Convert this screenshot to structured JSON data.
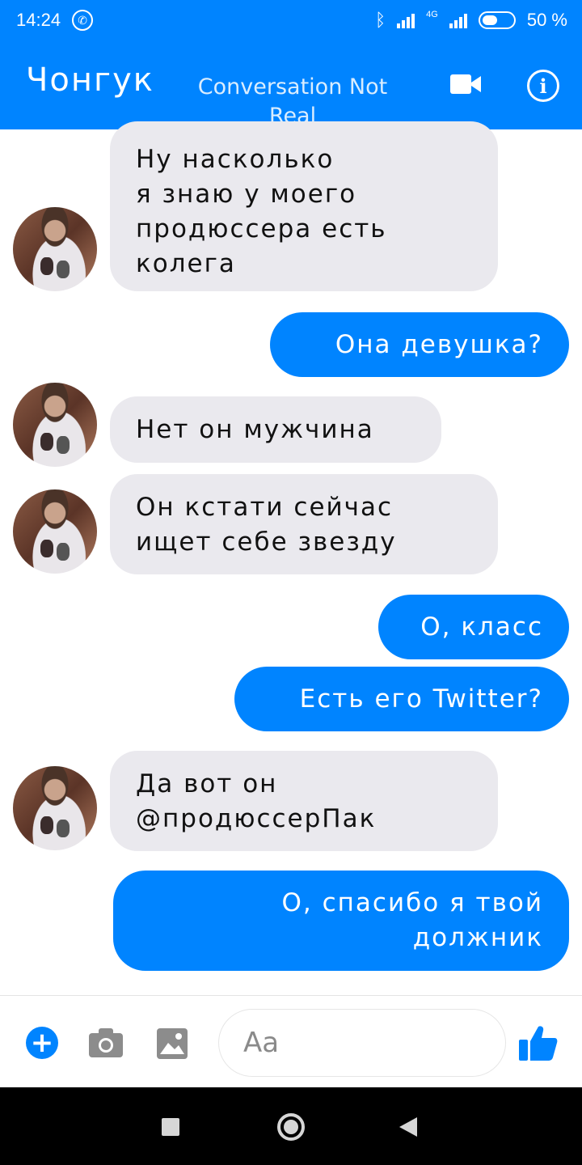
{
  "status_bar": {
    "time": "14:24",
    "network": "4G",
    "battery": "50 %",
    "battery_level": 0.5
  },
  "header": {
    "contact_name": "Чонгук",
    "subtitle": "Conversation Not Real",
    "icons": [
      "video-camera-icon",
      "info-icon"
    ]
  },
  "messages": [
    {
      "direction": "incoming",
      "text": "Ну  насколько\nя знаю у моего\nпродюссера есть\nколега"
    },
    {
      "direction": "outgoing",
      "text": "Она девушка?"
    },
    {
      "direction": "incoming",
      "text": "Нет он мужчина"
    },
    {
      "direction": "incoming",
      "text": "Он кстати сейчас\nищет себе звезду"
    },
    {
      "direction": "outgoing",
      "text": "О, класс"
    },
    {
      "direction": "outgoing",
      "text": "Есть его Twitter?"
    },
    {
      "direction": "incoming",
      "text": "Да вот он\n@продюссерПак"
    },
    {
      "direction": "outgoing",
      "text": "О, спасибо я твой\nдолжник"
    }
  ],
  "composer": {
    "placeholder": "Aa",
    "icons": [
      "plus-icon",
      "camera-icon",
      "gallery-icon",
      "thumbs-up-icon"
    ]
  },
  "colors": {
    "accent": "#0084ff",
    "incoming_bubble": "#eae9ee",
    "nav_bar": "#000000"
  }
}
